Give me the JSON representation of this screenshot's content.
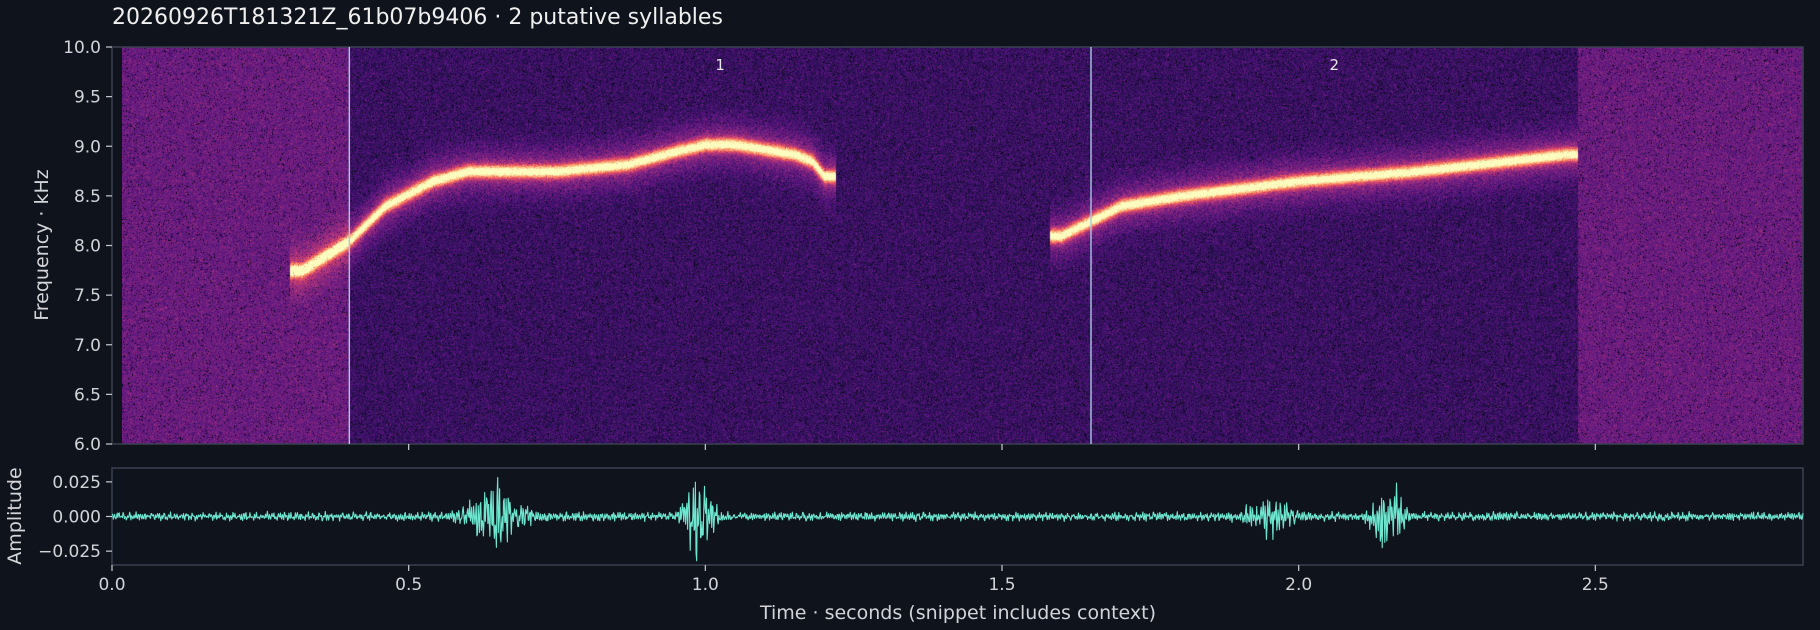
{
  "title": "20260926T181321Z_61b07b9406  ·  2 putative syllables",
  "colors": {
    "background": "#0f131c",
    "waveform": "#6ee7d0",
    "segment_line": "#a9c7e6",
    "spine": "#3a4150"
  },
  "chart_data": [
    {
      "type": "heatmap",
      "kind": "spectrogram",
      "ylabel": "Frequency · kHz",
      "xlim": [
        0.0,
        2.85
      ],
      "ylim": [
        6.0,
        10.0
      ],
      "xticks": [
        0.5,
        1.0,
        1.5,
        2.0,
        2.5
      ],
      "yticks": [
        "6.0",
        "6.5",
        "7.0",
        "7.5",
        "8.0",
        "8.5",
        "9.0",
        "9.5",
        "10.0"
      ],
      "colormap": "magma",
      "segments": [
        {
          "label": "1",
          "start": 0.4,
          "end": 1.65
        },
        {
          "label": "2",
          "start": 1.65,
          "end": 2.47
        }
      ],
      "syllable_traces": [
        {
          "label": "1",
          "time": [
            0.32,
            0.4,
            0.46,
            0.54,
            0.6,
            0.75,
            0.87,
            0.95,
            1.0,
            1.05,
            1.1,
            1.15,
            1.18,
            1.2
          ],
          "freq_khz": [
            7.75,
            8.05,
            8.4,
            8.65,
            8.75,
            8.75,
            8.82,
            8.95,
            9.02,
            9.02,
            8.97,
            8.92,
            8.85,
            8.7
          ]
        },
        {
          "label": "2",
          "time": [
            1.6,
            1.65,
            1.7,
            1.8,
            2.0,
            2.2,
            2.35,
            2.45
          ],
          "freq_khz": [
            8.1,
            8.25,
            8.4,
            8.5,
            8.65,
            8.75,
            8.85,
            8.92
          ]
        }
      ]
    },
    {
      "type": "line",
      "kind": "waveform",
      "xlabel": "Time · seconds (snippet includes context)",
      "ylabel": "Amplitude",
      "xlim": [
        0.0,
        2.85
      ],
      "ylim": [
        -0.035,
        0.035
      ],
      "xticks": [
        "0.0",
        "0.5",
        "1.0",
        "1.5",
        "2.0",
        "2.5"
      ],
      "yticks": [
        "0.025",
        "0.000",
        "−0.025"
      ],
      "baseline_amplitude": 0.003,
      "bursts": [
        {
          "center": 0.65,
          "width": 0.12,
          "amplitude": 0.02
        },
        {
          "center": 0.99,
          "width": 0.06,
          "amplitude": 0.03
        },
        {
          "center": 1.95,
          "width": 0.1,
          "amplitude": 0.012
        },
        {
          "center": 2.15,
          "width": 0.06,
          "amplitude": 0.028
        }
      ]
    }
  ]
}
